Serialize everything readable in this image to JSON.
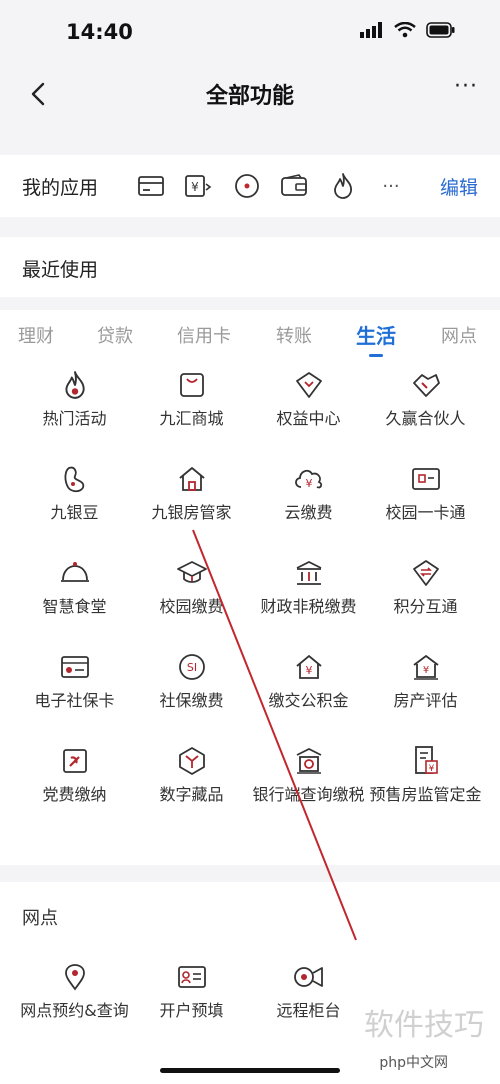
{
  "status": {
    "time": "14:40"
  },
  "header": {
    "title": "全部功能",
    "more": "···"
  },
  "my_apps": {
    "label": "我的应用",
    "edit": "编辑",
    "more": "···"
  },
  "recent": {
    "label": "最近使用"
  },
  "tabs": [
    "理财",
    "贷款",
    "信用卡",
    "转账",
    "生活",
    "网点"
  ],
  "active_tab": "生活",
  "life_items": [
    [
      "热门活动",
      "九汇商城",
      "权益中心",
      "久赢合伙人"
    ],
    [
      "九银豆",
      "九银房管家",
      "云缴费",
      "校园一卡通"
    ],
    [
      "智慧食堂",
      "校园缴费",
      "财政非税缴费",
      "积分互通"
    ],
    [
      "电子社保卡",
      "社保缴费",
      "缴交公积金",
      "房产评估"
    ],
    [
      "党费缴纳",
      "数字藏品",
      "银行端查询缴税",
      "预售房监管定金"
    ]
  ],
  "branch": {
    "title": "网点",
    "items": [
      "网点预约&查询",
      "开户预填",
      "远程柜台"
    ]
  },
  "watermark": {
    "main": "软件技巧",
    "sub": "php中文网"
  },
  "colors": {
    "accent": "#1f6fd6",
    "icon": "#b2272d",
    "edit": "#2a6ccf"
  }
}
